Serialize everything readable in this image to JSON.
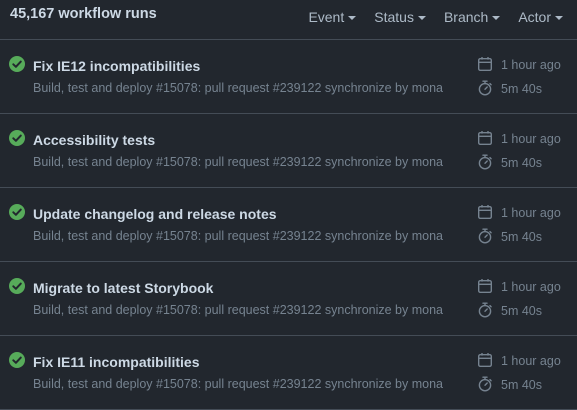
{
  "header": {
    "run_count": "45,167 workflow runs",
    "filters": [
      {
        "label": "Event"
      },
      {
        "label": "Status"
      },
      {
        "label": "Branch"
      },
      {
        "label": "Actor"
      }
    ]
  },
  "runs": [
    {
      "title": "Fix IE12 incompatibilities",
      "description": "Build, test and deploy #15078: pull request #239122 synchronize by mona",
      "time": "1 hour ago",
      "duration": "5m 40s",
      "status": "success"
    },
    {
      "title": "Accessibility tests",
      "description": "Build, test and deploy #15078: pull request #239122 synchronize by mona",
      "time": "1 hour ago",
      "duration": "5m 40s",
      "status": "success"
    },
    {
      "title": "Update changelog and release notes",
      "description": "Build, test and deploy #15078: pull request #239122 synchronize by mona",
      "time": "1 hour ago",
      "duration": "5m 40s",
      "status": "success"
    },
    {
      "title": "Migrate to latest Storybook",
      "description": "Build, test and deploy #15078: pull request #239122 synchronize by mona",
      "time": "1 hour ago",
      "duration": "5m 40s",
      "status": "success"
    },
    {
      "title": "Fix IE11 incompatibilities",
      "description": "Build, test and deploy #15078: pull request #239122 synchronize by mona",
      "time": "1 hour ago",
      "duration": "5m 40s",
      "status": "success"
    }
  ],
  "colors": {
    "background": "#22272e",
    "success": "#57ab5a",
    "border": "#444c56",
    "text_primary": "#cdd9e5",
    "text_muted": "#768390"
  },
  "icons": {
    "status": "check-circle-fill-icon",
    "time": "calendar-icon",
    "duration": "stopwatch-icon",
    "filter_dropdown": "caret-down-icon"
  }
}
